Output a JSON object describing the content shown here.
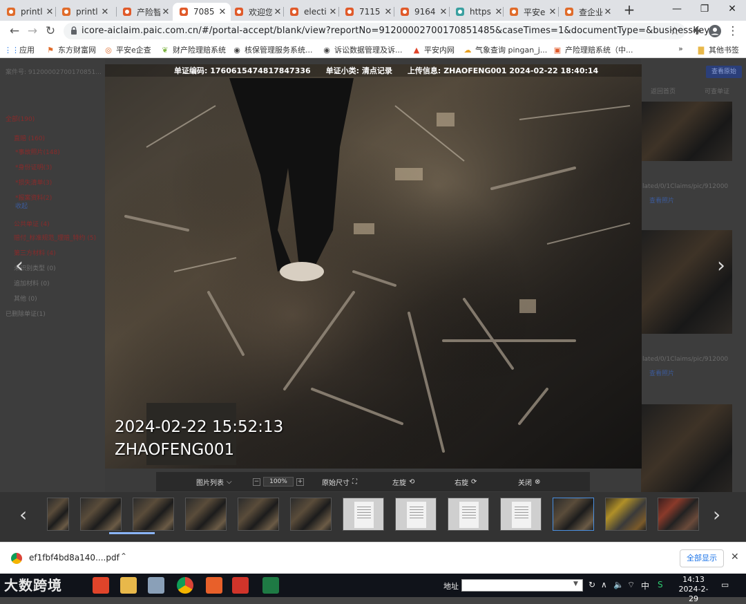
{
  "browser": {
    "tabs": [
      {
        "label": "printl",
        "icon": "chrome-app-icon"
      },
      {
        "label": "printl",
        "icon": "chrome-app-icon"
      },
      {
        "label": "产险智",
        "icon": "pingan-doc-icon"
      },
      {
        "label": "7085",
        "icon": "pingan-doc-icon",
        "active": true
      },
      {
        "label": "欢迎您",
        "icon": "pingan-doc-icon"
      },
      {
        "label": "electi",
        "icon": "pingan-doc-icon"
      },
      {
        "label": "7115",
        "icon": "pingan-doc-icon"
      },
      {
        "label": "9164",
        "icon": "pingan-doc-icon"
      },
      {
        "label": "https",
        "icon": "diamond-icon"
      },
      {
        "label": "平安e",
        "icon": "pingan-eye-icon"
      },
      {
        "label": "查企业",
        "icon": "pingan-eye-icon"
      }
    ],
    "url": "icore-aiclaim.paic.com.cn/#/portal-accept/blank/view?reportNo=91200002700170851485&caseTimes=1&documentType=&businessKey=",
    "bookmarks": [
      "应用",
      "东方财富网",
      "平安e企查",
      "财产险理赔系统",
      "核保管理服务系统...",
      "诉讼数据管理及诉...",
      "平安内网",
      "气象查询 pingan_j...",
      "产险理赔系统（中..."
    ],
    "bookmarks_other": "其他书签",
    "bookmarks_more": "»"
  },
  "page": {
    "case_no": "案件号: 91200002700170851...",
    "left_tree": [
      {
        "text": "全部(190)",
        "style": "red"
      },
      {
        "text": "直赔 (160)",
        "style": "red"
      },
      {
        "text": "*事故照片(148)",
        "style": "red"
      },
      {
        "text": "*身份证明(3)",
        "style": "red"
      },
      {
        "text": "*损失清单(3)",
        "style": "red"
      },
      {
        "text": "*报案资料(2)",
        "style": "red"
      },
      {
        "text": "收起",
        "style": "blue"
      },
      {
        "text": "公共单证 (4)",
        "style": "red"
      },
      {
        "text": "赔付_标准规范_理赔_特约 (5)",
        "style": "red"
      },
      {
        "text": "第三方材料 (4)",
        "style": "red"
      },
      {
        "text": "未识别类型 (0)",
        "style": "dim"
      },
      {
        "text": "追加材料 (0)",
        "style": "dim"
      },
      {
        "text": "其他 (0)",
        "style": "dim"
      },
      {
        "text": "已删除单证(1)",
        "style": "dim"
      }
    ],
    "right_top_button": "查看原始",
    "right_links": [
      "返回首页",
      "可查单证"
    ],
    "right_captions": [
      "lated/0/1Claims/pic/912000",
      "查看照片",
      "lated/0/1Claims/pic/912000",
      "查看照片"
    ]
  },
  "viewer": {
    "info": {
      "doc_code_label": "单证编码:",
      "doc_code": "1760615474817847336",
      "doc_type_label": "单证小类:",
      "doc_type": "清点记录",
      "upload_label": "上传信息:",
      "upload_info": "ZHAOFENG001 2024-02-22 18:40:14"
    },
    "photo_timestamp": "2024-02-22 15:52:13",
    "photo_user": "ZHAOFENG001",
    "toolbar": {
      "list_label": "图片列表",
      "zoom_value": "100%",
      "zoom_out": "−",
      "zoom_in": "+",
      "original_size": "原始尺寸",
      "rotate_left": "左旋",
      "rotate_right": "右旋",
      "close": "关闭"
    },
    "thumbnails": [
      "photo",
      "photo",
      "photo",
      "photo",
      "photo",
      "photo",
      "doc",
      "doc",
      "doc",
      "doc",
      "photo-selected",
      "photo-yellow",
      "photo-red"
    ],
    "nav_prev": "‹",
    "nav_next": "›"
  },
  "download": {
    "file_name": "ef1fbf4bd8a140....pdf",
    "show_all": "全部显示",
    "close": "✕"
  },
  "taskbar": {
    "brand": "大数跨境",
    "address_label": "地址",
    "ime": "中",
    "time": "14:13",
    "date": "2024-2-29"
  }
}
